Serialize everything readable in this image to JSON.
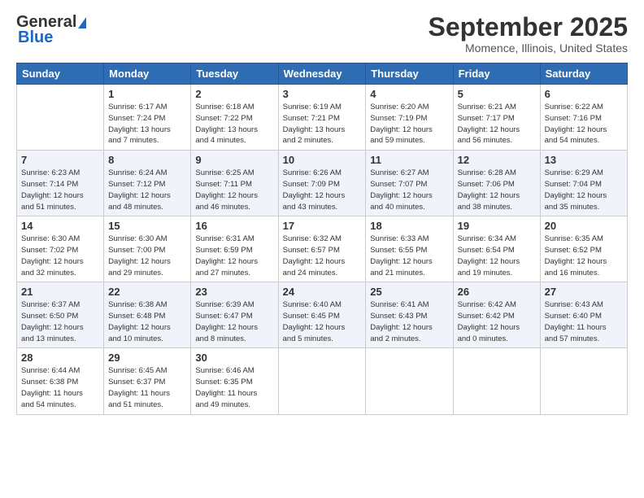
{
  "header": {
    "logo_general": "General",
    "logo_blue": "Blue",
    "title": "September 2025",
    "location": "Momence, Illinois, United States"
  },
  "columns": [
    "Sunday",
    "Monday",
    "Tuesday",
    "Wednesday",
    "Thursday",
    "Friday",
    "Saturday"
  ],
  "weeks": [
    [
      {
        "day": "",
        "info": ""
      },
      {
        "day": "1",
        "info": "Sunrise: 6:17 AM\nSunset: 7:24 PM\nDaylight: 13 hours\nand 7 minutes."
      },
      {
        "day": "2",
        "info": "Sunrise: 6:18 AM\nSunset: 7:22 PM\nDaylight: 13 hours\nand 4 minutes."
      },
      {
        "day": "3",
        "info": "Sunrise: 6:19 AM\nSunset: 7:21 PM\nDaylight: 13 hours\nand 2 minutes."
      },
      {
        "day": "4",
        "info": "Sunrise: 6:20 AM\nSunset: 7:19 PM\nDaylight: 12 hours\nand 59 minutes."
      },
      {
        "day": "5",
        "info": "Sunrise: 6:21 AM\nSunset: 7:17 PM\nDaylight: 12 hours\nand 56 minutes."
      },
      {
        "day": "6",
        "info": "Sunrise: 6:22 AM\nSunset: 7:16 PM\nDaylight: 12 hours\nand 54 minutes."
      }
    ],
    [
      {
        "day": "7",
        "info": "Sunrise: 6:23 AM\nSunset: 7:14 PM\nDaylight: 12 hours\nand 51 minutes."
      },
      {
        "day": "8",
        "info": "Sunrise: 6:24 AM\nSunset: 7:12 PM\nDaylight: 12 hours\nand 48 minutes."
      },
      {
        "day": "9",
        "info": "Sunrise: 6:25 AM\nSunset: 7:11 PM\nDaylight: 12 hours\nand 46 minutes."
      },
      {
        "day": "10",
        "info": "Sunrise: 6:26 AM\nSunset: 7:09 PM\nDaylight: 12 hours\nand 43 minutes."
      },
      {
        "day": "11",
        "info": "Sunrise: 6:27 AM\nSunset: 7:07 PM\nDaylight: 12 hours\nand 40 minutes."
      },
      {
        "day": "12",
        "info": "Sunrise: 6:28 AM\nSunset: 7:06 PM\nDaylight: 12 hours\nand 38 minutes."
      },
      {
        "day": "13",
        "info": "Sunrise: 6:29 AM\nSunset: 7:04 PM\nDaylight: 12 hours\nand 35 minutes."
      }
    ],
    [
      {
        "day": "14",
        "info": "Sunrise: 6:30 AM\nSunset: 7:02 PM\nDaylight: 12 hours\nand 32 minutes."
      },
      {
        "day": "15",
        "info": "Sunrise: 6:30 AM\nSunset: 7:00 PM\nDaylight: 12 hours\nand 29 minutes."
      },
      {
        "day": "16",
        "info": "Sunrise: 6:31 AM\nSunset: 6:59 PM\nDaylight: 12 hours\nand 27 minutes."
      },
      {
        "day": "17",
        "info": "Sunrise: 6:32 AM\nSunset: 6:57 PM\nDaylight: 12 hours\nand 24 minutes."
      },
      {
        "day": "18",
        "info": "Sunrise: 6:33 AM\nSunset: 6:55 PM\nDaylight: 12 hours\nand 21 minutes."
      },
      {
        "day": "19",
        "info": "Sunrise: 6:34 AM\nSunset: 6:54 PM\nDaylight: 12 hours\nand 19 minutes."
      },
      {
        "day": "20",
        "info": "Sunrise: 6:35 AM\nSunset: 6:52 PM\nDaylight: 12 hours\nand 16 minutes."
      }
    ],
    [
      {
        "day": "21",
        "info": "Sunrise: 6:37 AM\nSunset: 6:50 PM\nDaylight: 12 hours\nand 13 minutes."
      },
      {
        "day": "22",
        "info": "Sunrise: 6:38 AM\nSunset: 6:48 PM\nDaylight: 12 hours\nand 10 minutes."
      },
      {
        "day": "23",
        "info": "Sunrise: 6:39 AM\nSunset: 6:47 PM\nDaylight: 12 hours\nand 8 minutes."
      },
      {
        "day": "24",
        "info": "Sunrise: 6:40 AM\nSunset: 6:45 PM\nDaylight: 12 hours\nand 5 minutes."
      },
      {
        "day": "25",
        "info": "Sunrise: 6:41 AM\nSunset: 6:43 PM\nDaylight: 12 hours\nand 2 minutes."
      },
      {
        "day": "26",
        "info": "Sunrise: 6:42 AM\nSunset: 6:42 PM\nDaylight: 12 hours\nand 0 minutes."
      },
      {
        "day": "27",
        "info": "Sunrise: 6:43 AM\nSunset: 6:40 PM\nDaylight: 11 hours\nand 57 minutes."
      }
    ],
    [
      {
        "day": "28",
        "info": "Sunrise: 6:44 AM\nSunset: 6:38 PM\nDaylight: 11 hours\nand 54 minutes."
      },
      {
        "day": "29",
        "info": "Sunrise: 6:45 AM\nSunset: 6:37 PM\nDaylight: 11 hours\nand 51 minutes."
      },
      {
        "day": "30",
        "info": "Sunrise: 6:46 AM\nSunset: 6:35 PM\nDaylight: 11 hours\nand 49 minutes."
      },
      {
        "day": "",
        "info": ""
      },
      {
        "day": "",
        "info": ""
      },
      {
        "day": "",
        "info": ""
      },
      {
        "day": "",
        "info": ""
      }
    ]
  ]
}
